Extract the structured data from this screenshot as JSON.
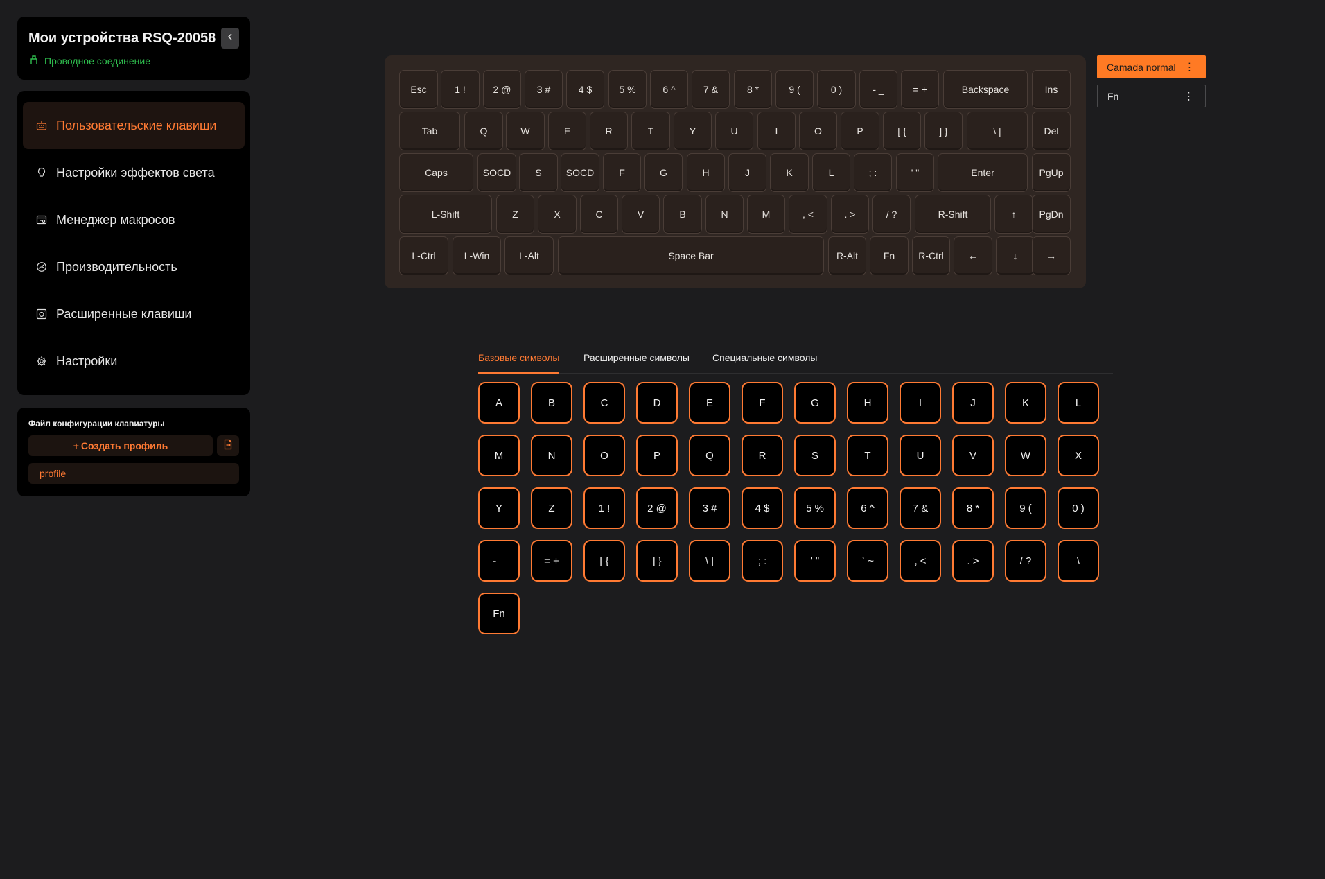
{
  "device": {
    "title": "Мои устройства RSQ-20058",
    "connection": "Проводное соединение",
    "collapse_icon": "chevron-left-icon"
  },
  "nav": {
    "items": [
      {
        "label": "Пользовательские клавиши",
        "icon": "keyboard-icon",
        "active": true
      },
      {
        "label": "Настройки эффектов света",
        "icon": "lightbulb-icon",
        "active": false
      },
      {
        "label": "Менеджер макросов",
        "icon": "macro-icon",
        "active": false
      },
      {
        "label": "Производительность",
        "icon": "gauge-icon",
        "active": false
      },
      {
        "label": "Расширенные клавиши",
        "icon": "advanced-key-icon",
        "active": false
      },
      {
        "label": "Настройки",
        "icon": "gear-icon",
        "active": false
      }
    ]
  },
  "profiles": {
    "config_label": "Файл конфигурации клавиатуры",
    "create_label": "Создать профиль",
    "create_prefix": "+",
    "items": [
      "profile"
    ]
  },
  "keyboard": {
    "rows": [
      [
        "Esc",
        "1 !",
        "2 @",
        "3 #",
        "4 $",
        "5 %",
        "6 ^",
        "7 &",
        "8 *",
        "9 (",
        "0 )",
        "- _",
        "= +",
        "Backspace",
        "Ins"
      ],
      [
        "Tab",
        "Q",
        "W",
        "E",
        "R",
        "T",
        "Y",
        "U",
        "I",
        "O",
        "P",
        "[ {",
        "] }",
        "\\ |",
        "Del"
      ],
      [
        "Caps",
        "SOCD",
        "S",
        "SOCD",
        "F",
        "G",
        "H",
        "J",
        "K",
        "L",
        "; :",
        "' \"",
        "Enter",
        "PgUp"
      ],
      [
        "L-Shift",
        "Z",
        "X",
        "C",
        "V",
        "B",
        "N",
        "M",
        ", <",
        ". >",
        "/ ?",
        "R-Shift",
        "↑",
        "PgDn"
      ],
      [
        "L-Ctrl",
        "L-Win",
        "L-Alt",
        "Space Bar",
        "R-Alt",
        "Fn",
        "R-Ctrl",
        "←",
        "↓",
        "→"
      ]
    ]
  },
  "layers": [
    {
      "label": "Camada normal",
      "active": true
    },
    {
      "label": "Fn",
      "active": false
    }
  ],
  "tabs": [
    {
      "label": "Базовые символы",
      "active": true
    },
    {
      "label": "Расширенные символы",
      "active": false
    },
    {
      "label": "Специальные символы",
      "active": false
    }
  ],
  "symbols": [
    "A",
    "B",
    "C",
    "D",
    "E",
    "F",
    "G",
    "H",
    "I",
    "J",
    "K",
    "L",
    "M",
    "N",
    "O",
    "P",
    "Q",
    "R",
    "S",
    "T",
    "U",
    "V",
    "W",
    "X",
    "Y",
    "Z",
    "1 !",
    "2 @",
    "3 #",
    "4 $",
    "5 %",
    "6 ^",
    "7 &",
    "8 *",
    "9 (",
    "0 )",
    "- _",
    "= +",
    "[ {",
    "] }",
    "\\ |",
    "; :",
    "' \"",
    "` ~",
    ", <",
    ". >",
    "/ ?",
    "\\",
    "Fn"
  ],
  "colors": {
    "accent": "#ff7a33",
    "connected": "#2fbf4f",
    "background": "#1c1c1e",
    "keyboard_body": "#2f2622"
  }
}
